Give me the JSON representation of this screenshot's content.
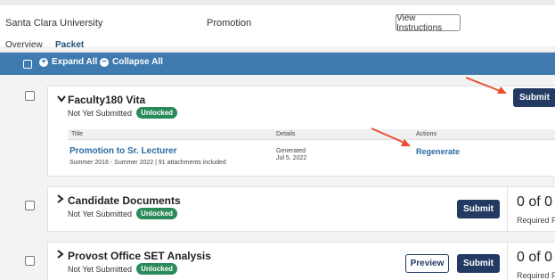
{
  "header": {
    "university": "Santa Clara University",
    "case_type": "Promotion",
    "view_instructions_label": "View Instructions"
  },
  "tabs": [
    {
      "label": "Overview"
    },
    {
      "label": "Packet"
    }
  ],
  "toolbar": {
    "expand_all": "Expand All",
    "collapse_all": "Collapse All"
  },
  "sections": [
    {
      "title": "Faculty180 Vita",
      "status": "Not Yet Submitted",
      "badge": "Unlocked",
      "submit_label": "Submit",
      "table": {
        "headers": {
          "title": "Title",
          "details": "Details",
          "actions": "Actions"
        },
        "row": {
          "title": "Promotion to Sr. Lecturer",
          "meta": "Summer 2016 - Summer 2022 | 91 attachments included",
          "details_line1": "Generated",
          "details_line2": "Jul 5, 2022",
          "action": "Regenerate"
        }
      }
    },
    {
      "title": "Candidate Documents",
      "status": "Not Yet Submitted",
      "badge": "Unlocked",
      "submit_label": "Submit",
      "count": "0 of 0",
      "count_label": "Required File"
    },
    {
      "title": "Provost Office SET Analysis",
      "status": "Not Yet Submitted",
      "badge": "Unlocked",
      "preview_label": "Preview",
      "submit_label": "Submit",
      "count": "0 of 0",
      "count_label": "Required File"
    }
  ],
  "colors": {
    "toolbar_bg": "#3f7bb0",
    "primary_button": "#233a63",
    "unlocked_badge": "#2b8a5a",
    "link": "#2a6aa3",
    "annotation_arrow": "#e8502f"
  }
}
